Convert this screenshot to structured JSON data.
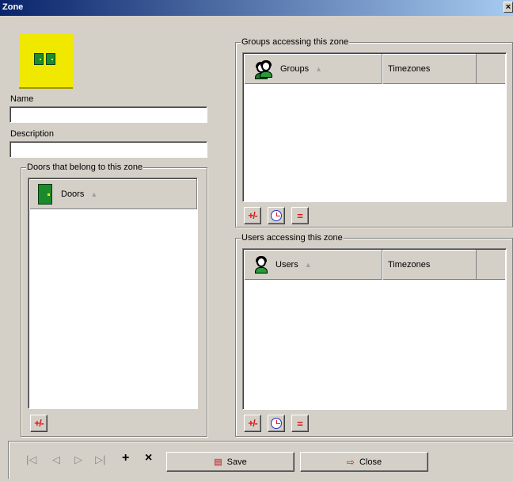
{
  "window": {
    "title": "Zone",
    "close_glyph": "×"
  },
  "form": {
    "name_label": "Name",
    "name_value": "",
    "description_label": "Description",
    "description_value": ""
  },
  "doors_box": {
    "legend": "Doors that belong to this zone",
    "columns": [
      {
        "label": "Doors",
        "icon": "door-icon"
      }
    ],
    "rows": [],
    "add_remove_label": "+/-"
  },
  "groups_box": {
    "legend": "Groups accessing this zone",
    "columns": [
      {
        "label": "Groups",
        "icon": "group-icon"
      },
      {
        "label": "Timezones"
      }
    ],
    "rows": [],
    "buttons": {
      "add_remove": "+/-",
      "timezone": "clock-icon",
      "equal": "="
    }
  },
  "users_box": {
    "legend": "Users accessing this zone",
    "columns": [
      {
        "label": "Users",
        "icon": "user-icon"
      },
      {
        "label": "Timezones"
      }
    ],
    "rows": [],
    "buttons": {
      "add_remove": "+/-",
      "timezone": "clock-icon",
      "equal": "="
    }
  },
  "navigator": {
    "first": "|◁",
    "prev": "◁",
    "next": "▷",
    "last": "▷|",
    "add": "+",
    "delete": "×"
  },
  "actions": {
    "save_label": "Save",
    "close_label": "Close"
  },
  "colors": {
    "title_bar": "#0a246a",
    "accent_red": "#e01010",
    "door_green": "#1a8a2a",
    "icon_yellow": "#f1e800"
  }
}
